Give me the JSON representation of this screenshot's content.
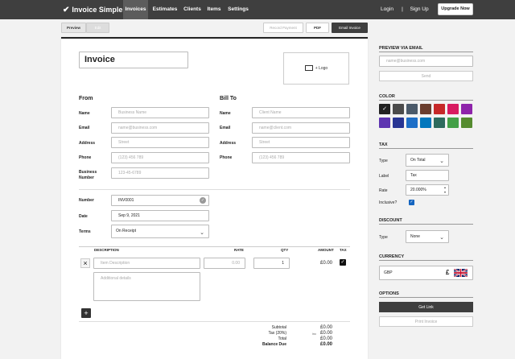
{
  "nav": {
    "brand": "Invoice Simple",
    "links": [
      "Invoices",
      "Estimates",
      "Clients",
      "Items",
      "Settings"
    ],
    "login": "Login",
    "separator": "|",
    "signup": "Sign Up",
    "upgrade": "Upgrade Now"
  },
  "toolbar": {
    "preview": "Preview",
    "edit": "Edit",
    "record_payment": "Record Payment",
    "pdf": "PDF",
    "email": "Email Invoice"
  },
  "doc": {
    "title": "Invoice",
    "logo": "+ Logo",
    "from": {
      "heading": "From",
      "name_label": "Name",
      "name_ph": "Business Name",
      "email_label": "Email",
      "email_ph": "name@business.com",
      "address_label": "Address",
      "address_ph": "Street",
      "phone_label": "Phone",
      "phone_ph": "(123) 456 789",
      "bn_label1": "Business",
      "bn_label2": "Number",
      "bn_ph": "123-45-6789"
    },
    "bill": {
      "heading": "Bill To",
      "name_label": "Name",
      "name_ph": "Client Name",
      "email_label": "Email",
      "email_ph": "name@client.com",
      "address_label": "Address",
      "address_ph": "Street",
      "phone_label": "Phone",
      "phone_ph": "(123) 456 789"
    },
    "meta": {
      "number_label": "Number",
      "number": "INV0001",
      "date_label": "Date",
      "date": "Sep 9, 2021",
      "terms_label": "Terms",
      "terms": "On Receipt"
    },
    "items": {
      "cols": [
        "DESCRIPTION",
        "RATE",
        "QTY",
        "AMOUNT",
        "TAX"
      ],
      "desc_ph": "Item Description",
      "details_ph": "Additional details",
      "rate_ph": "0.00",
      "qty": "1",
      "amount": "£0.00",
      "delete": "×",
      "add": "+"
    },
    "totals": {
      "subtotal_label": "Subtotal",
      "subtotal": "£0.00",
      "tax_label": "Tax (20%)",
      "tax_note": "inc",
      "tax": "£0.00",
      "total_label": "Total",
      "total": "£0.00",
      "due_label": "Balance Due",
      "due": "£0.00"
    }
  },
  "side": {
    "preview_email": {
      "heading": "PREVIEW VIA EMAIL",
      "placeholder": "name@business.com",
      "send": "Send"
    },
    "color": {
      "heading": "COLOR",
      "swatches": [
        "#222222",
        "#4b4b4b",
        "#4b5a6a",
        "#6b3e2e",
        "#c62828",
        "#d81b60",
        "#8e24aa",
        "#5e35b1",
        "#283593",
        "#1e6fc7",
        "#0277bd",
        "#2e6b5e",
        "#43a047",
        "#558b2f"
      ],
      "selected": 0
    },
    "tax": {
      "heading": "TAX",
      "type_label": "Type",
      "type": "On Total",
      "label_label": "Label",
      "label": "Tax",
      "rate_label": "Rate",
      "rate": "20.000%",
      "inclusive_label": "Inclusive?"
    },
    "discount": {
      "heading": "DISCOUNT",
      "type_label": "Type",
      "type": "None"
    },
    "currency": {
      "heading": "CURRENCY",
      "code": "GBP",
      "symbol": "£"
    },
    "options": {
      "heading": "OPTIONS",
      "get_link": "Get Link",
      "print": "Print Invoice"
    }
  }
}
